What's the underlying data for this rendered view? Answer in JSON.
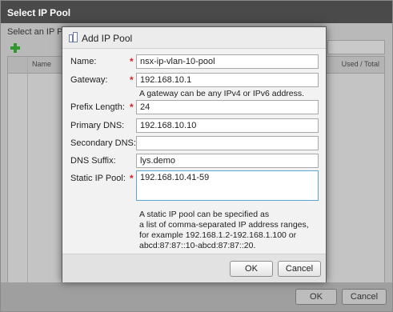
{
  "outer_window": {
    "title": "Select IP Pool",
    "subtitle": "Select an IP Poo",
    "columns": {
      "name": "Name",
      "used_total": "Used / Total"
    },
    "ok_label": "OK",
    "cancel_label": "Cancel"
  },
  "dialog": {
    "title": "Add IP Pool",
    "fields": {
      "name": {
        "label": "Name:",
        "value": "nsx-ip-vlan-10-pool",
        "required": "*"
      },
      "gateway": {
        "label": "Gateway:",
        "value": "192.168.10.1",
        "required": "*",
        "hint": "A gateway can be any IPv4 or IPv6 address."
      },
      "prefix_length": {
        "label": "Prefix Length:",
        "value": "24",
        "required": "*"
      },
      "primary_dns": {
        "label": "Primary DNS:",
        "value": "192.168.10.10"
      },
      "secondary_dns": {
        "label": "Secondary DNS:",
        "value": ""
      },
      "dns_suffix": {
        "label": "DNS Suffix:",
        "value": "lys.demo"
      },
      "static_ip_pool": {
        "label": "Static IP Pool:",
        "value": "192.168.10.41-59",
        "required": "*"
      }
    },
    "static_hint": [
      "A static IP pool can be specified as",
      "a list of comma-separated IP address ranges,",
      "for example 192.168.1.2-192.168.1.100 or",
      "abcd:87:87::10-abcd:87:87::20."
    ],
    "ok_label": "OK",
    "cancel_label": "Cancel"
  },
  "icons": {
    "add": "plus-icon",
    "dialog": "network-pool-icon"
  },
  "colors": {
    "required": "#dd2222",
    "add_icon": "#2e9a2e",
    "focus_border": "#5aa6d8"
  }
}
